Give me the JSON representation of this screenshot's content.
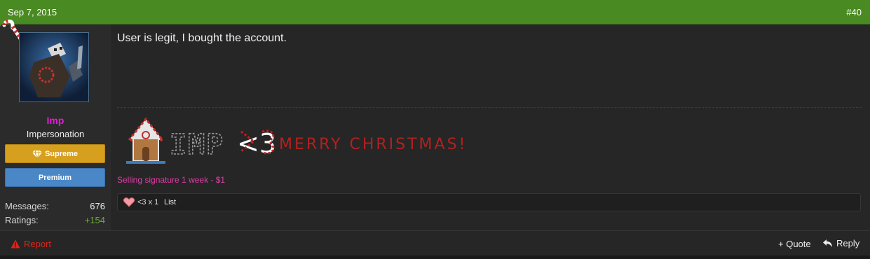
{
  "post": {
    "date": "Sep 7, 2015",
    "number": "#40"
  },
  "user": {
    "name": "Imp",
    "title": "Impersonation",
    "badges": [
      {
        "label": "Supreme",
        "icon": "diamond-icon",
        "color": "#d6a01e"
      },
      {
        "label": "Premium",
        "color": "#4a87c6"
      }
    ],
    "stats": {
      "messages_label": "Messages:",
      "messages_value": "676",
      "ratings_label": "Ratings:",
      "ratings_value": "+154"
    },
    "name_color": "#e21bd6"
  },
  "message": {
    "text": "User is legit, I bought the account."
  },
  "signature": {
    "banner_name": "IMP",
    "banner_heart": "<3",
    "banner_text": "MERRY CHRISTMAS!",
    "selling_text": "Selling signature 1 week - $1"
  },
  "reactions": {
    "icon": "heart-icon",
    "summary": "<3 x 1",
    "list_label": "List"
  },
  "footer": {
    "report_label": "Report",
    "quote_label": "+ Quote",
    "reply_label": "Reply"
  },
  "colors": {
    "header_green": "#4a8a22",
    "report_red": "#d9261c",
    "rating_green": "#6cae34"
  }
}
